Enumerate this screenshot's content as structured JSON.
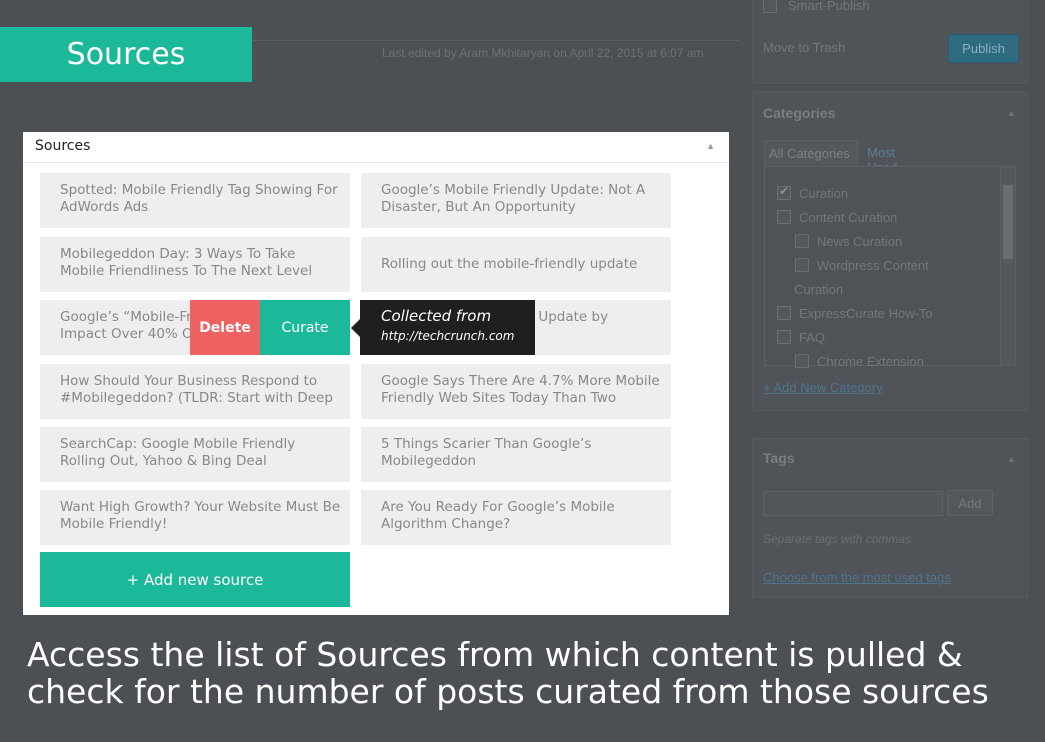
{
  "background": {
    "last_edited": "Last edited by Aram Mkhitaryan on April 22, 2015 at 6:07 am",
    "publish_box": {
      "smart_publish": "Smart-Publish",
      "move_to_trash": "Move to Trash",
      "publish_label": "Publish"
    },
    "categories": {
      "title": "Categories",
      "tab_all": "All Categories",
      "tab_used": "Most Used",
      "items": [
        {
          "label": "Curation",
          "checked": true,
          "indent": 0
        },
        {
          "label": "Content Curation",
          "checked": false,
          "indent": 0
        },
        {
          "label": "News Curation",
          "checked": false,
          "indent": 1
        },
        {
          "label": "Wordpress Content",
          "checked": false,
          "indent": 1
        },
        {
          "label": "Curation",
          "checked": false,
          "indent": 0,
          "wrap": true
        },
        {
          "label": "ExpressCurate How-To",
          "checked": false,
          "indent": 0
        },
        {
          "label": "FAQ",
          "checked": false,
          "indent": 0
        },
        {
          "label": "Chrome Extension",
          "checked": false,
          "indent": 1
        }
      ],
      "add_new": "+ Add New Category"
    },
    "tags": {
      "title": "Tags",
      "add_label": "Add",
      "hint": "Separate tags with commas",
      "choose_link": "Choose from the most used tags"
    }
  },
  "banner": {
    "title": "Sources"
  },
  "panel": {
    "title": "Sources",
    "sources": [
      {
        "title": "Spotted: Mobile Friendly Tag Showing For AdWords Ads"
      },
      {
        "title": "Google’s Mobile Friendly Update: Not A Disaster, But An Opportunity"
      },
      {
        "title": "Mobilegeddon Day: 3 Ways To Take Mobile Friendliness To The Next Level"
      },
      {
        "title": "Rolling out the mobile-friendly update"
      },
      {
        "title": "Google’s “Mobile-Friendly” Update Could Impact Over 40% Of Fortune 500"
      },
      {
        "title": "Google’s Impending … Update by"
      },
      {
        "title": "How Should Your Business Respond to #Mobilegeddon? (TLDR: Start with Deep"
      },
      {
        "title": "Google Says There Are 4.7% More Mobile Friendly Web Sites Today Than Two"
      },
      {
        "title": "SearchCap: Google Mobile Friendly Rolling Out, Yahoo & Bing Deal"
      },
      {
        "title": "5 Things Scarier Than Google’s Mobilegeddon"
      },
      {
        "title": "Want High Growth? Your Website Must Be Mobile Friendly!"
      },
      {
        "title": "Are You Ready For Google’s Mobile Algorithm Change?"
      }
    ],
    "hover_actions": {
      "delete_label": "Delete",
      "curate_label": "Curate"
    },
    "tooltip": {
      "title": "Collected from",
      "url": "http://techcrunch.com"
    },
    "add_source_label": "+ Add new source"
  },
  "caption": {
    "line1": "Access the list of Sources from which content is pulled &",
    "line2": "check for the number of posts curated from those sources"
  },
  "colors": {
    "accent": "#1bb99a",
    "delete": "#ee6262",
    "tooltip_bg": "#1f1f1f",
    "overlay_bg": "#4c4f54"
  }
}
